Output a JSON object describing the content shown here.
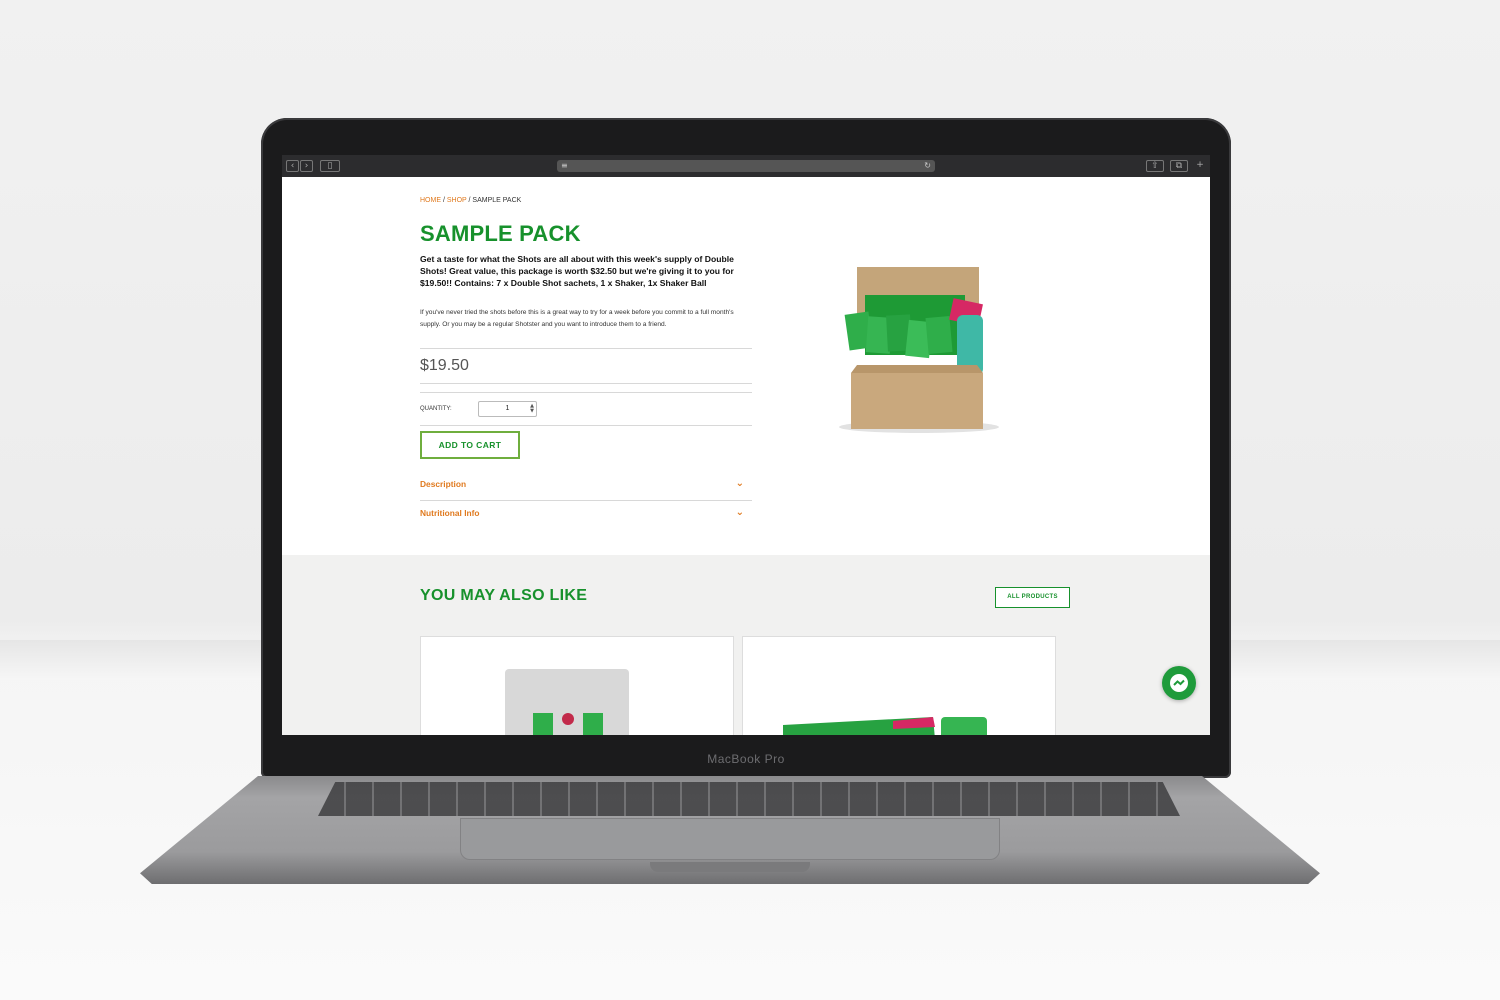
{
  "laptop": {
    "model_label": "MacBook Pro"
  },
  "browser": {
    "back_icon": "chevron-left-icon",
    "forward_icon": "chevron-right-icon",
    "sidebar_icon": "sidebar-icon",
    "reader_icon": "reader-icon",
    "reload_icon": "reload-icon",
    "share_icon": "share-icon",
    "tabs_icon": "tabs-icon",
    "new_tab_icon": "plus-icon"
  },
  "breadcrumb": {
    "home": "HOME",
    "shop": "SHOP",
    "current": "SAMPLE PACK",
    "separator": " / "
  },
  "product": {
    "title": "SAMPLE PACK",
    "lead": "Get a taste for what the Shots are all about with this week's supply of Double Shots! Great value, this package is worth $32.50 but we're giving it to you for $19.50!! Contains: 7 x Double Shot sachets, 1 x Shaker, 1x Shaker Ball",
    "body": "If you've never tried the shots before this is a great way to try for a week before you commit to a full month's supply. Or you may be a regular Shotster and you want to introduce them to a friend.",
    "price": "$19.50",
    "quantity_label": "QUANTITY:",
    "quantity_value": "1",
    "add_to_cart": "ADD TO CART",
    "accordions": [
      {
        "label": "Description"
      },
      {
        "label": "Nutritional Info"
      }
    ]
  },
  "related": {
    "title": "YOU MAY ALSO LIKE",
    "all_products": "ALL PRODUCTS"
  },
  "colors": {
    "brand_green": "#17912c",
    "accent_orange": "#e07a1f",
    "button_border": "#6fae3e"
  },
  "messenger": {
    "icon": "messenger-icon"
  }
}
